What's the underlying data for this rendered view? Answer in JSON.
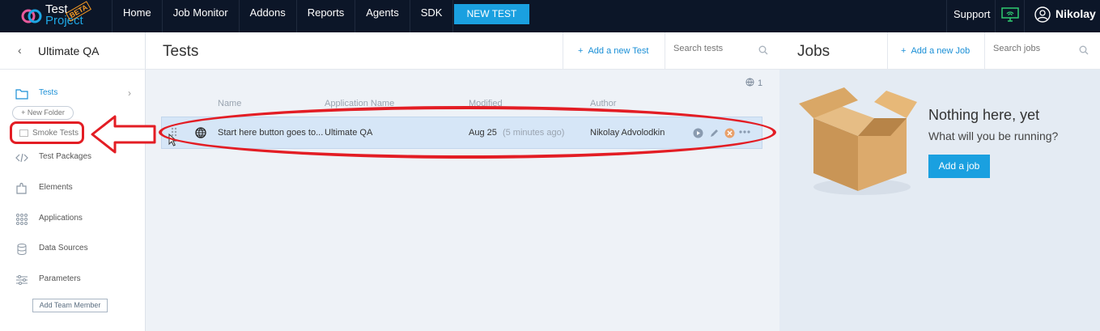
{
  "app": {
    "logo_line1": "Test",
    "logo_line2": "Project",
    "beta": "BETA"
  },
  "nav": {
    "items": [
      "Home",
      "Job Monitor",
      "Addons",
      "Reports",
      "Agents",
      "SDK"
    ],
    "new_test": "NEW TEST",
    "support": "Support",
    "user": "Nikolay"
  },
  "sidebar": {
    "project": "Ultimate QA",
    "items": [
      {
        "label": "Tests",
        "icon": "folder-icon"
      },
      {
        "label": "Test Packages",
        "icon": "code-icon"
      },
      {
        "label": "Elements",
        "icon": "puzzle-icon"
      },
      {
        "label": "Applications",
        "icon": "grid-icon"
      },
      {
        "label": "Data Sources",
        "icon": "database-icon"
      },
      {
        "label": "Parameters",
        "icon": "sliders-icon"
      }
    ],
    "new_folder": "+ New Folder",
    "smoke_tests": "Smoke Tests",
    "add_team_member": "Add Team Member"
  },
  "tests": {
    "title": "Tests",
    "add_label": "Add a new Test",
    "search_placeholder": "Search tests",
    "count": "1",
    "columns": [
      "Name",
      "Application Name",
      "Modified",
      "Author"
    ],
    "rows": [
      {
        "name": "Start here button goes to...",
        "application": "Ultimate QA",
        "modified": "Aug 25",
        "modified_rel": "(5 minutes ago)",
        "author": "Nikolay Advolodkin"
      }
    ]
  },
  "jobs": {
    "title": "Jobs",
    "add_label": "Add a new Job",
    "search_placeholder": "Search jobs",
    "empty_title": "Nothing here, yet",
    "empty_sub": "What will you be running?",
    "add_button": "Add a job"
  },
  "colors": {
    "topbar": "#0c1628",
    "accent": "#1aa0e0",
    "annotation": "#e31d24",
    "row_selected": "#d6e6f7"
  }
}
